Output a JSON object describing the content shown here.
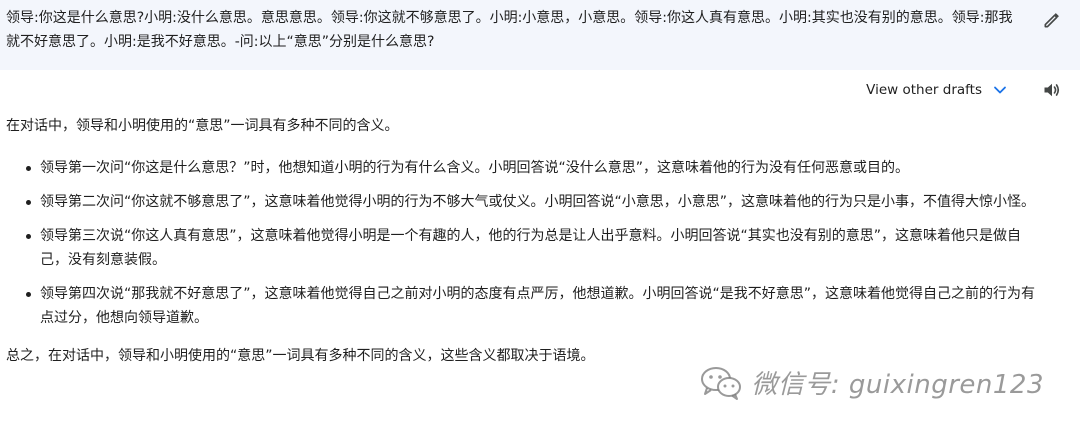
{
  "prompt": {
    "text": "领导:你这是什么意思?小明:没什么意思。意思意思。领导:你这就不够意思了。小明:小意思，小意思。领导:你这人真有意思。小明:其实也没有别的意思。领导:那我就不好意思了。小明:是我不好意思。-问:以上“意思”分别是什么意思?"
  },
  "toolbar": {
    "drafts_label": "View other drafts",
    "icons": {
      "edit": "pencil-icon",
      "drafts": "chevron-down-icon",
      "speaker": "speaker-icon"
    },
    "accent_color": "#1a73e8"
  },
  "answer": {
    "intro": "在对话中，领导和小明使用的“意思”一词具有多种不同的含义。",
    "bullets": [
      "领导第一次问“你这是什么意思？”时，他想知道小明的行为有什么含义。小明回答说“没什么意思”，这意味着他的行为没有任何恶意或目的。",
      "领导第二次问“你这就不够意思了”，这意味着他觉得小明的行为不够大气或仗义。小明回答说“小意思，小意思”，这意味着他的行为只是小事，不值得大惊小怪。",
      "领导第三次说“你这人真有意思”，这意味着他觉得小明是一个有趣的人，他的行为总是让人出乎意料。小明回答说“其实也没有别的意思”，这意味着他只是做自己，没有刻意装假。",
      "领导第四次说“那我就不好意思了”，这意味着他觉得自己之前对小明的态度有点严厉，他想道歉。小明回答说“是我不好意思”，这意味着他觉得自己之前的行为有点过分，他想向领导道歉。"
    ],
    "summary": "总之，在对话中，领导和小明使用的“意思”一词具有多种不同的含义，这些含义都取决于语境。"
  },
  "watermark": {
    "text": "微信号: guixingren123",
    "icon": "wechat-icon"
  }
}
